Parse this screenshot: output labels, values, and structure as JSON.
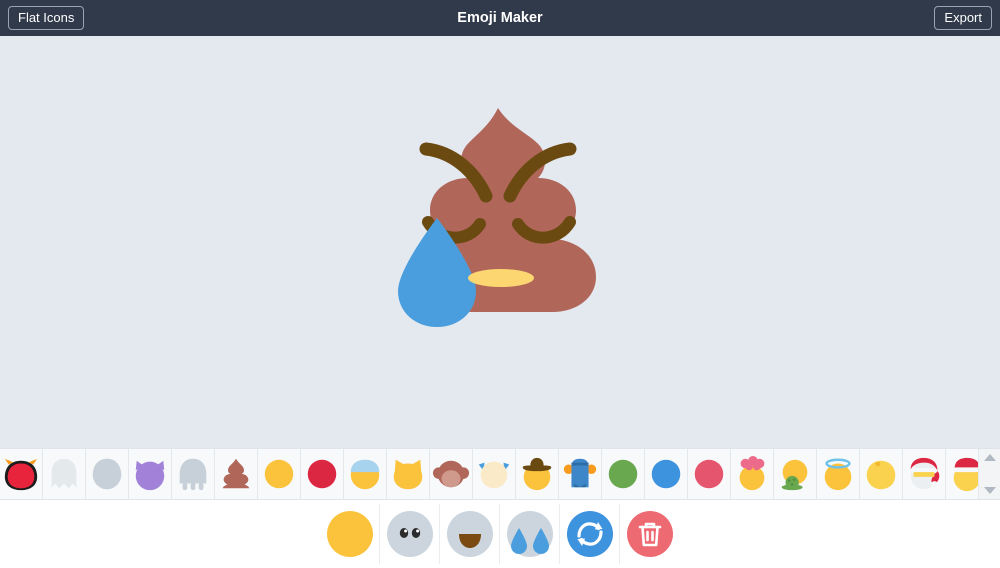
{
  "header": {
    "left_button": "Flat Icons",
    "title": "Emoji Maker",
    "right_button": "Export"
  },
  "canvas": {
    "background_color": "#e4e9f0",
    "emoji": {
      "name": "crying-poop-emoji",
      "base": {
        "name": "poop-base",
        "color": "#b0675a"
      },
      "eyebrows": {
        "name": "angry-eyebrows",
        "color": "#6b4a12"
      },
      "eyes": {
        "name": "closed-eyes",
        "color": "#6b4a12"
      },
      "mouth": {
        "name": "flat-oval-mouth",
        "color": "#fcd670"
      },
      "tear": {
        "name": "tear-drop",
        "color": "#4a9ede"
      }
    }
  },
  "icon_strip": {
    "selected_index": 0,
    "items": [
      {
        "name": "red-monster-head",
        "colors": [
          "#e8243c",
          "#1c1c1c",
          "#f79a1e"
        ]
      },
      {
        "name": "white-ghost",
        "colors": [
          "#e3e8ec"
        ]
      },
      {
        "name": "gray-alien-head",
        "colors": [
          "#c7d0d8"
        ]
      },
      {
        "name": "purple-devil-head",
        "colors": [
          "#a182d8"
        ]
      },
      {
        "name": "gray-ghost-legs",
        "colors": [
          "#c7d0d8"
        ]
      },
      {
        "name": "brown-poop",
        "colors": [
          "#b0675a"
        ]
      },
      {
        "name": "yellow-circle-face",
        "colors": [
          "#fbc23c"
        ]
      },
      {
        "name": "red-circle-face",
        "colors": [
          "#dc2743"
        ]
      },
      {
        "name": "yellow-face-blue-cap",
        "colors": [
          "#fbc23c",
          "#a8d3ee"
        ]
      },
      {
        "name": "yellow-cat-face",
        "colors": [
          "#fbc23c"
        ]
      },
      {
        "name": "brown-monkey-face",
        "colors": [
          "#b0675a",
          "#cf9a8c"
        ]
      },
      {
        "name": "cream-face-blue-bows",
        "colors": [
          "#fbeac8",
          "#4a9ede"
        ]
      },
      {
        "name": "yellow-face-cowboy-hat",
        "colors": [
          "#fbc23c",
          "#6b4a12"
        ]
      },
      {
        "name": "blue-robot-figure",
        "colors": [
          "#3d87c9",
          "#f79a1e"
        ]
      },
      {
        "name": "green-circle-face",
        "colors": [
          "#6aa84f"
        ]
      },
      {
        "name": "blue-circle-face",
        "colors": [
          "#3d93dd"
        ]
      },
      {
        "name": "pink-circle-face",
        "colors": [
          "#e6556e"
        ]
      },
      {
        "name": "yellow-face-pink-flowers",
        "colors": [
          "#fbc23c",
          "#ed6b8a"
        ]
      },
      {
        "name": "yellow-face-green-bush",
        "colors": [
          "#fbc23c",
          "#6aa84f"
        ]
      },
      {
        "name": "yellow-face-halo",
        "colors": [
          "#fbc23c",
          "#6ec1e8"
        ]
      },
      {
        "name": "yellow-face-curl",
        "colors": [
          "#fbd24e"
        ]
      },
      {
        "name": "santa-face-red-hat",
        "colors": [
          "#dc2743",
          "#eceff1"
        ]
      },
      {
        "name": "yellow-face-santa-hat",
        "colors": [
          "#fbc23c",
          "#dc2743"
        ]
      }
    ],
    "scrollbar": {
      "up": "scroll-up",
      "down": "scroll-down"
    }
  },
  "toolbar": {
    "buttons": [
      {
        "name": "base-shape-button",
        "label": "Base",
        "color": "#fbc23c"
      },
      {
        "name": "eyes-button",
        "label": "Eyes",
        "color": "#ccd5dd"
      },
      {
        "name": "mouth-button",
        "label": "Mouth",
        "color": "#ccd5dd"
      },
      {
        "name": "tears-button",
        "label": "Tears",
        "color": "#ccd5dd"
      },
      {
        "name": "shuffle-button",
        "label": "Randomize",
        "color": "#3d93dd"
      },
      {
        "name": "delete-button",
        "label": "Delete",
        "color": "#ee6a72"
      }
    ]
  },
  "colors": {
    "header_bg": "#303a4b",
    "canvas_bg": "#e4e9f0",
    "strip_bg": "#f7f9fa",
    "toolbar_bg": "#ffffff"
  }
}
